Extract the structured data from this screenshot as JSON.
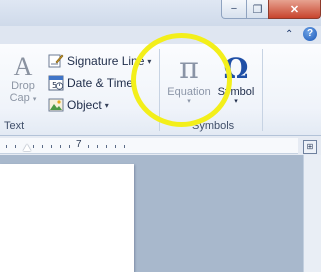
{
  "window": {
    "minimize_label": "−",
    "restore_label": "❐",
    "close_label": "✕"
  },
  "ribbon": {
    "caret_label": "⌃",
    "help_label": "?",
    "text_group": {
      "drop_cap": {
        "label_line1": "Drop",
        "label_line2": "Cap",
        "glyph": "A"
      },
      "signature_line": {
        "label": "Signature Line",
        "icon": "signature-line-icon"
      },
      "date_time": {
        "label": "Date & Time",
        "icon": "date-time-icon"
      },
      "object": {
        "label": "Object",
        "icon": "object-icon"
      },
      "group_label": "Text"
    },
    "symbols_group": {
      "equation": {
        "label": "Equation",
        "glyph": "π",
        "state": "disabled"
      },
      "symbol": {
        "label": "Symbol",
        "glyph": "Ω"
      },
      "group_label": "Symbols"
    }
  },
  "ruler": {
    "number": "7"
  },
  "highlight_color": "#f3ef1a"
}
